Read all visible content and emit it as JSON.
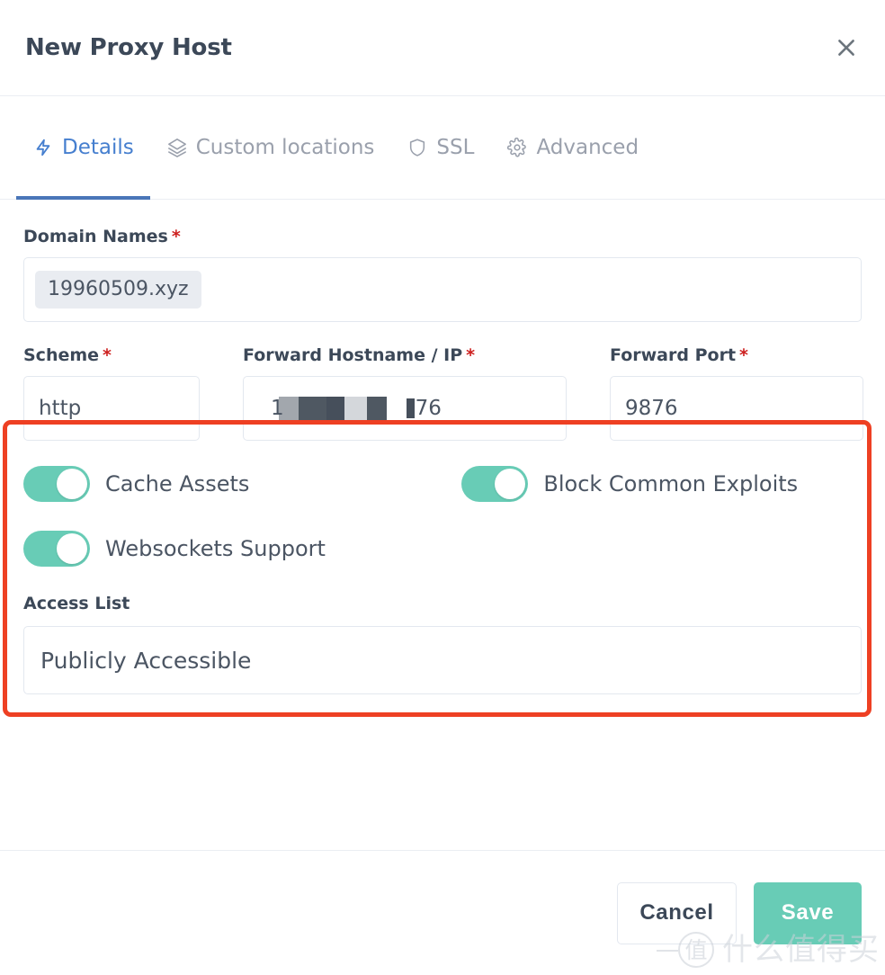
{
  "modal": {
    "title": "New Proxy Host",
    "close_icon": "close-icon"
  },
  "tabs": [
    {
      "label": "Details",
      "icon": "bolt-icon",
      "active": true
    },
    {
      "label": "Custom locations",
      "icon": "layers-icon",
      "active": false
    },
    {
      "label": "SSL",
      "icon": "shield-icon",
      "active": false
    },
    {
      "label": "Advanced",
      "icon": "gear-icon",
      "active": false
    }
  ],
  "form": {
    "domain_names": {
      "label": "Domain Names",
      "required_marker": "*",
      "tags": [
        "19960509.xyz"
      ]
    },
    "scheme": {
      "label": "Scheme",
      "required_marker": "*",
      "value": "http"
    },
    "forward_hostname": {
      "label": "Forward Hostname / IP",
      "required_marker": "*",
      "value_lead": "1",
      "value_tail": "76",
      "redacted": true
    },
    "forward_port": {
      "label": "Forward Port",
      "required_marker": "*",
      "value": "9876"
    },
    "toggles": [
      {
        "label": "Cache Assets",
        "on": true
      },
      {
        "label": "Block Common Exploits",
        "on": true
      },
      {
        "label": "Websockets Support",
        "on": true
      }
    ],
    "access_list": {
      "label": "Access List",
      "value": "Publicly Accessible"
    }
  },
  "footer": {
    "cancel_label": "Cancel",
    "save_label": "Save"
  },
  "watermark": {
    "logo_char": "值",
    "text": "什么值得买"
  },
  "colors": {
    "accent_blue": "#467fcf",
    "teal": "#68ccb6",
    "highlight_red": "#ee4023",
    "required_red": "#cd201f",
    "text_dark": "#3c4858",
    "text_muted": "#9aa0ac",
    "border": "#e3e8ef"
  }
}
